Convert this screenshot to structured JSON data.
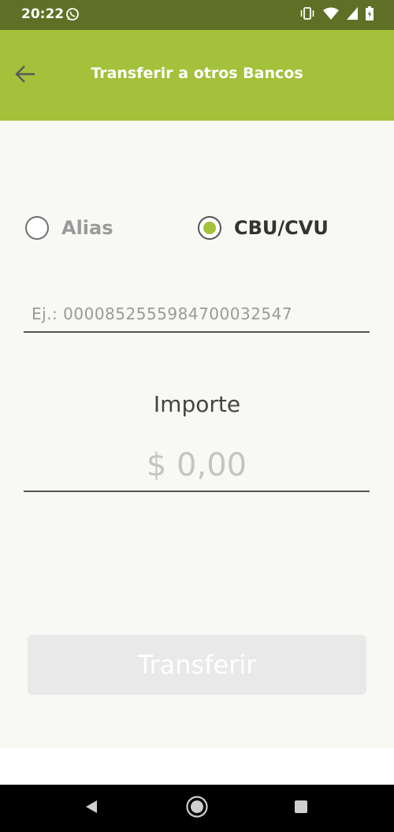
{
  "status_bar": {
    "time": "20:22",
    "icons": [
      "whatsapp-icon",
      "vibrate-icon",
      "wifi-icon",
      "signal-icon",
      "battery-icon"
    ]
  },
  "app_bar": {
    "title": "Transferir a otros Bancos",
    "back_icon": "arrow-left-icon"
  },
  "destination_type": {
    "options": [
      {
        "label": "Alias",
        "selected": false
      },
      {
        "label": "CBU/CVU",
        "selected": true
      }
    ]
  },
  "cbu_field": {
    "placeholder": "Ej.: 0000852555984700032547",
    "value": ""
  },
  "amount": {
    "label": "Importe",
    "placeholder": "$ 0,00",
    "value": ""
  },
  "transfer_button": {
    "label": "Transferir",
    "enabled": false
  },
  "colors": {
    "app_bar": "#a3c13a",
    "status_bar": "#5f7026",
    "radio_accent": "#a3c13a",
    "content_bg": "#f8f8f4",
    "button_disabled": "#e9e9e9"
  },
  "nav_bar": {
    "icons": [
      "nav-back-icon",
      "nav-home-icon",
      "nav-recents-icon"
    ]
  }
}
